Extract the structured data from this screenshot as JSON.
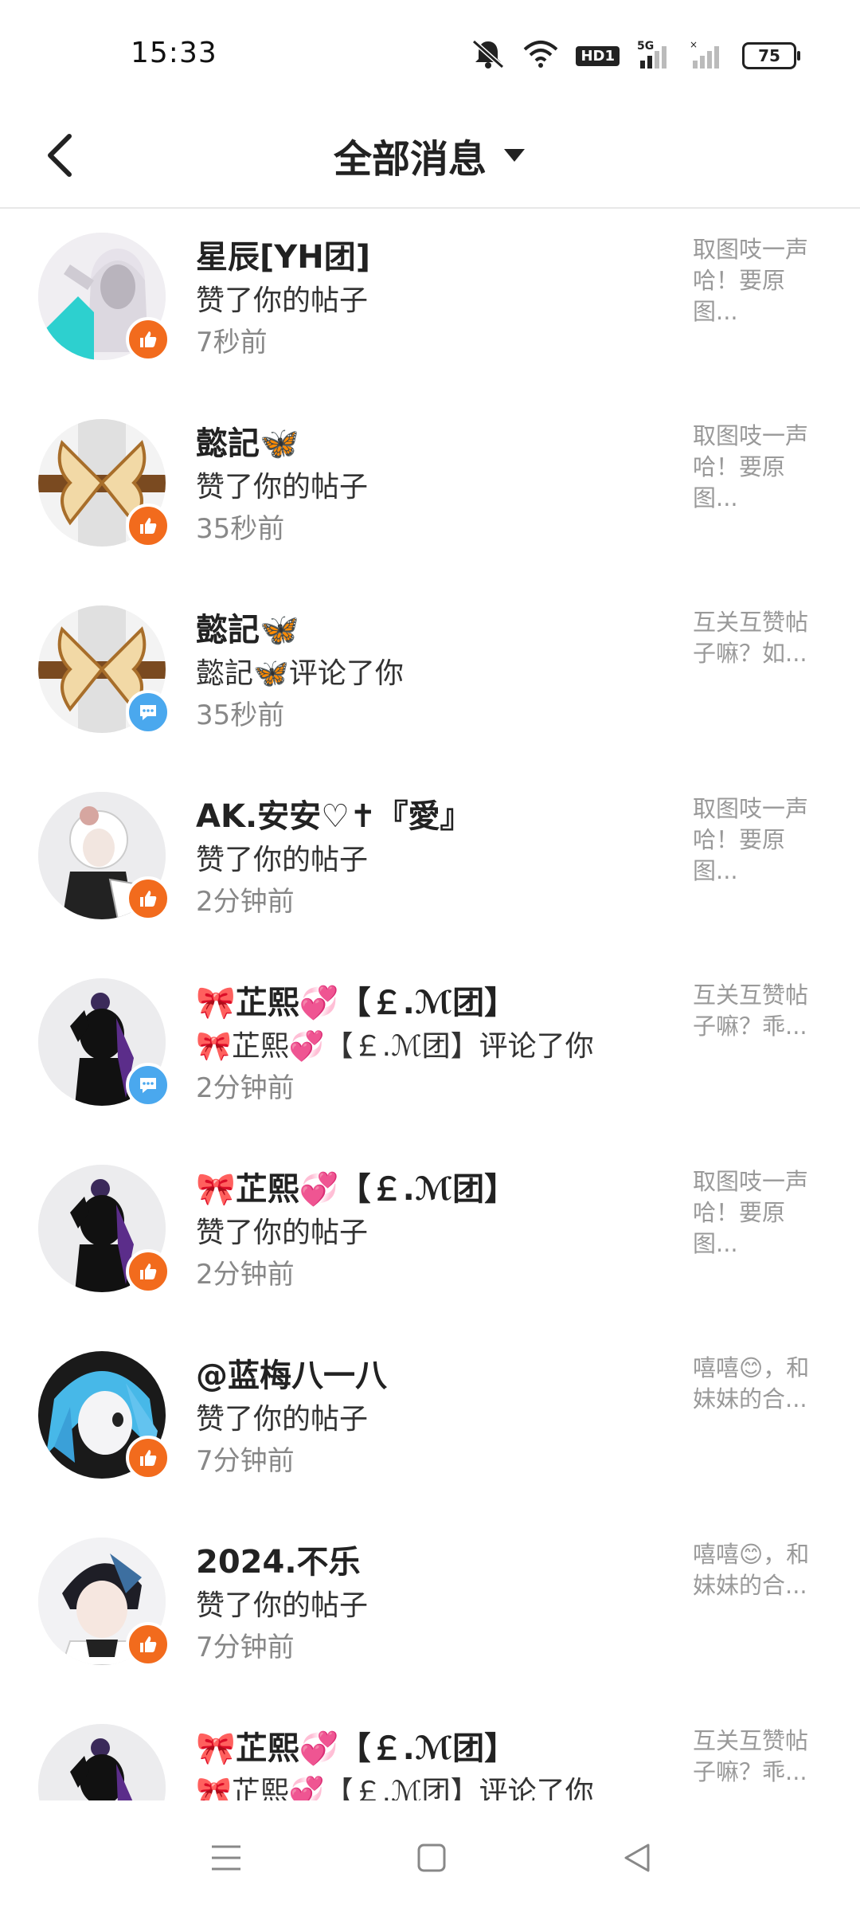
{
  "status_bar": {
    "time": "15:33",
    "network": "5G",
    "hd_label": "HD1",
    "battery": "75"
  },
  "header": {
    "title": "全部消息",
    "back_icon": "chevron-left-icon",
    "dropdown_icon": "caret-down-icon"
  },
  "messages": [
    {
      "name": "星辰[YH团]",
      "action": "赞了你的帖子",
      "time": "7秒前",
      "preview": "取图吱一声哈！要原图...",
      "type": "like"
    },
    {
      "name": "懿記🦋",
      "action": "赞了你的帖子",
      "time": "35秒前",
      "preview": "取图吱一声哈！要原图...",
      "type": "like"
    },
    {
      "name": "懿記🦋",
      "action": "懿記🦋评论了你",
      "time": "35秒前",
      "preview": "互关互赞帖子嘛？如...",
      "type": "comment"
    },
    {
      "name": "AK.安安♡✝『愛』",
      "action": "赞了你的帖子",
      "time": "2分钟前",
      "preview": "取图吱一声哈！要原图...",
      "type": "like"
    },
    {
      "name": "🎀芷熙💞【￡.ℳ团】",
      "action": "🎀芷熙💞【￡.ℳ团】评论了你",
      "time": "2分钟前",
      "preview": "互关互赞帖子嘛？乖...",
      "type": "comment"
    },
    {
      "name": "🎀芷熙💞【￡.ℳ团】",
      "action": "赞了你的帖子",
      "time": "2分钟前",
      "preview": "取图吱一声哈！要原图...",
      "type": "like"
    },
    {
      "name": "@蓝梅八一八",
      "action": "赞了你的帖子",
      "time": "7分钟前",
      "preview": "嘻嘻😊，和妹妹的合...",
      "type": "like"
    },
    {
      "name": "2024.不乐",
      "action": "赞了你的帖子",
      "time": "7分钟前",
      "preview": "嘻嘻😊，和妹妹的合...",
      "type": "like"
    },
    {
      "name": "🎀芷熙💞【￡.ℳ团】",
      "action": "🎀芷熙💞【￡.ℳ团】评论了你",
      "time": "",
      "preview": "互关互赞帖子嘛？乖...",
      "type": "comment"
    }
  ],
  "colors": {
    "like_badge": "#f26b1d",
    "comment_badge": "#4aa8ee",
    "text_primary": "#222222",
    "text_secondary": "#888888"
  },
  "nav_bar": {
    "menu_icon": "menu-icon",
    "home_icon": "square-home-icon",
    "back_icon": "triangle-back-icon"
  }
}
